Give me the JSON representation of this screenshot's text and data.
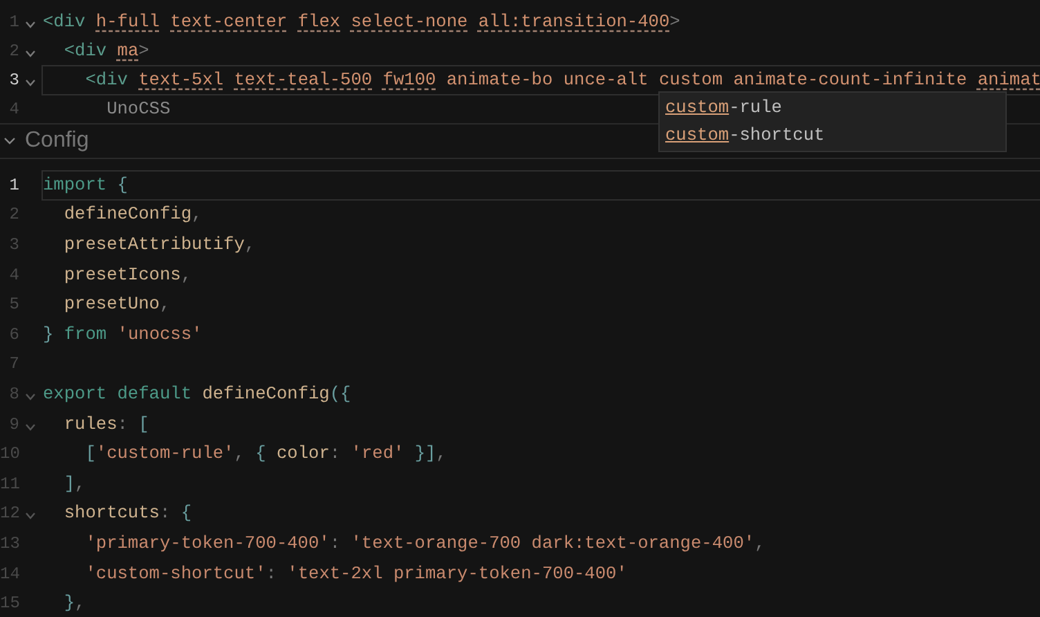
{
  "top_editor": {
    "lines": [
      {
        "number": "1",
        "fold": true,
        "current": false,
        "tokens": [
          {
            "text": "<div",
            "kind": "tag"
          },
          {
            "text": " h-full",
            "kind": "attr",
            "underline": true
          },
          {
            "text": " text-center",
            "kind": "attr",
            "underline": true
          },
          {
            "text": " flex",
            "kind": "attr",
            "underline": true
          },
          {
            "text": " select-none",
            "kind": "attr",
            "underline": true
          },
          {
            "text": " all:transition-400",
            "kind": "attr",
            "underline": true
          },
          {
            "text": ">",
            "kind": "punct"
          }
        ]
      },
      {
        "number": "2",
        "fold": true,
        "current": false,
        "tokens": [
          {
            "text": "  <div",
            "kind": "tag"
          },
          {
            "text": " ma",
            "kind": "attr",
            "underline": true
          },
          {
            "text": ">",
            "kind": "punct"
          }
        ]
      },
      {
        "number": "3",
        "fold": true,
        "current": true,
        "tokens": [
          {
            "text": "    <div",
            "kind": "tag"
          },
          {
            "text": " text-5xl",
            "kind": "attr",
            "underline": true
          },
          {
            "text": " text-teal-500",
            "kind": "attr",
            "underline": true
          },
          {
            "text": " fw100",
            "kind": "attr",
            "underline": true
          },
          {
            "text": " animate-bo unce-alt custom animate-count-infinite",
            "kind": "attr",
            "underline": false
          },
          {
            "text": " animat",
            "kind": "attr",
            "underline": true
          }
        ]
      },
      {
        "number": "4",
        "fold": false,
        "current": false,
        "tokens": [
          {
            "text": "      UnoCSS",
            "kind": "text"
          }
        ]
      }
    ],
    "suggestions": [
      {
        "match": "custom",
        "rest": "-rule"
      },
      {
        "match": "custom",
        "rest": "-shortcut"
      }
    ]
  },
  "section": {
    "title": "Config",
    "expanded": true
  },
  "config_editor": {
    "lines": [
      {
        "number": "1",
        "fold": false,
        "current": true,
        "tokens": [
          {
            "text": "import",
            "kind": "keyword"
          },
          {
            "text": " {",
            "kind": "brace"
          }
        ]
      },
      {
        "number": "2",
        "fold": false,
        "current": false,
        "tokens": [
          {
            "text": "  defineConfig",
            "kind": "ident"
          },
          {
            "text": ",",
            "kind": "punct"
          }
        ]
      },
      {
        "number": "3",
        "fold": false,
        "current": false,
        "tokens": [
          {
            "text": "  presetAttributify",
            "kind": "ident"
          },
          {
            "text": ",",
            "kind": "punct"
          }
        ]
      },
      {
        "number": "4",
        "fold": false,
        "current": false,
        "tokens": [
          {
            "text": "  presetIcons",
            "kind": "ident"
          },
          {
            "text": ",",
            "kind": "punct"
          }
        ]
      },
      {
        "number": "5",
        "fold": false,
        "current": false,
        "tokens": [
          {
            "text": "  presetUno",
            "kind": "ident"
          },
          {
            "text": ",",
            "kind": "punct"
          }
        ]
      },
      {
        "number": "6",
        "fold": false,
        "current": false,
        "tokens": [
          {
            "text": "}",
            "kind": "brace"
          },
          {
            "text": " from",
            "kind": "keyword"
          },
          {
            "text": " 'unocss'",
            "kind": "string"
          }
        ]
      },
      {
        "number": "7",
        "fold": false,
        "current": false
      },
      {
        "number": "8",
        "fold": true,
        "current": false,
        "tokens": [
          {
            "text": "export default",
            "kind": "keyword"
          },
          {
            "text": " defineConfig",
            "kind": "ident"
          },
          {
            "text": "({",
            "kind": "brace"
          }
        ]
      },
      {
        "number": "9",
        "fold": true,
        "current": false,
        "tokens": [
          {
            "text": "  rules",
            "kind": "ident"
          },
          {
            "text": ":",
            "kind": "punct"
          },
          {
            "text": " [",
            "kind": "brace"
          }
        ]
      },
      {
        "number": "10",
        "fold": false,
        "current": false,
        "tokens": [
          {
            "text": "    [",
            "kind": "brace"
          },
          {
            "text": "'custom-rule'",
            "kind": "string"
          },
          {
            "text": ",",
            "kind": "punct"
          },
          {
            "text": " {",
            "kind": "brace"
          },
          {
            "text": " color",
            "kind": "ident"
          },
          {
            "text": ":",
            "kind": "punct"
          },
          {
            "text": " 'red'",
            "kind": "string"
          },
          {
            "text": " }]",
            "kind": "brace"
          },
          {
            "text": ",",
            "kind": "punct"
          }
        ]
      },
      {
        "number": "11",
        "fold": false,
        "current": false,
        "tokens": [
          {
            "text": "  ]",
            "kind": "brace"
          },
          {
            "text": ",",
            "kind": "punct"
          }
        ]
      },
      {
        "number": "12",
        "fold": true,
        "current": false,
        "tokens": [
          {
            "text": "  shortcuts",
            "kind": "ident"
          },
          {
            "text": ":",
            "kind": "punct"
          },
          {
            "text": " {",
            "kind": "brace"
          }
        ]
      },
      {
        "number": "13",
        "fold": false,
        "current": false,
        "tokens": [
          {
            "text": "    'primary-token-700-400'",
            "kind": "string"
          },
          {
            "text": ":",
            "kind": "punct"
          },
          {
            "text": " 'text-orange-700 dark:text-orange-400'",
            "kind": "string"
          },
          {
            "text": ",",
            "kind": "punct"
          }
        ]
      },
      {
        "number": "14",
        "fold": false,
        "current": false,
        "tokens": [
          {
            "text": "    'custom-shortcut'",
            "kind": "string"
          },
          {
            "text": ":",
            "kind": "punct"
          },
          {
            "text": " 'text-2xl primary-token-700-400'",
            "kind": "string"
          }
        ]
      },
      {
        "number": "15",
        "fold": false,
        "current": false,
        "tokens": [
          {
            "text": "  }",
            "kind": "brace"
          },
          {
            "text": ",",
            "kind": "punct"
          }
        ]
      }
    ]
  }
}
